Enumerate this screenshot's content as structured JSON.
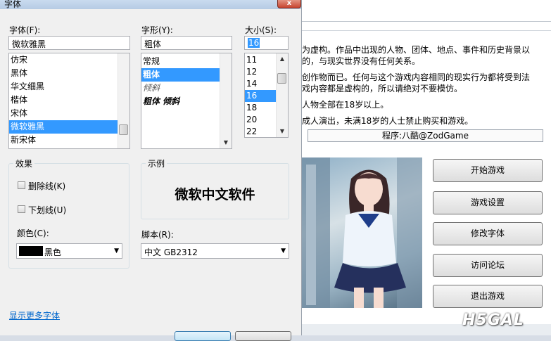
{
  "dialog": {
    "title": "字体",
    "close_glyph": "x",
    "font_label": "字体(F):",
    "font_value": "微软雅黑",
    "fonts": [
      "仿宋",
      "黑体",
      "华文细黑",
      "楷体",
      "宋体",
      "微软雅黑",
      "新宋体"
    ],
    "font_selected": "微软雅黑",
    "style_label": "字形(Y):",
    "style_value": "粗体",
    "styles": [
      "常规",
      "粗体",
      "倾斜",
      "粗体 倾斜"
    ],
    "style_selected": "粗体",
    "size_label": "大小(S):",
    "size_value": "16",
    "sizes": [
      "11",
      "12",
      "14",
      "16",
      "18",
      "20",
      "22"
    ],
    "size_selected": "16",
    "effects_title": "效果",
    "strike_label": "删除线(K)",
    "underline_label": "下划线(U)",
    "color_label": "颜色(C):",
    "color_value": "黑色",
    "color_hex": "#000000",
    "sample_title": "示例",
    "sample_text": "微软中文软件",
    "script_label": "脚本(R):",
    "script_value": "中文 GB2312",
    "more_fonts_link": "显示更多字体"
  },
  "game": {
    "notice_lines": [
      "为虚构。作品中出现的人物、团体、地点、事件和历史背景以",
      "的，与现实世界没有任何关系。",
      "创作物而已。任何与这个游戏内容相同的现实行为都将受到法",
      "戏内容都是虚构的，所以请绝对不要模仿。",
      "人物全部在18岁以上。",
      "成人演出，未满18岁的人士禁止购买和游戏。"
    ],
    "credit": "程序:八酷@ZodGame",
    "buttons": [
      "开始游戏",
      "游戏设置",
      "修改字体",
      "访问论坛",
      "退出游戏"
    ],
    "watermark": "H5GAL"
  }
}
